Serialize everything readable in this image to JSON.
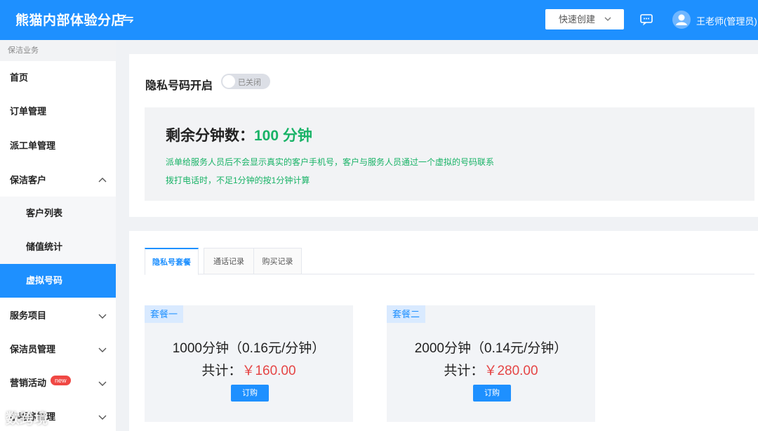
{
  "header": {
    "title": "熊猫内部体验分店",
    "switch_icon": "⇋",
    "quick_create": "快速创建",
    "user_name": "王老师(管理员)"
  },
  "sidebar": {
    "section": "保洁业务",
    "items": [
      {
        "label": "首页"
      },
      {
        "label": "订单管理"
      },
      {
        "label": "派工单管理"
      },
      {
        "label": "保洁客户"
      },
      {
        "label": "客户列表"
      },
      {
        "label": "储值统计"
      },
      {
        "label": "虚拟号码"
      },
      {
        "label": "服务项目"
      },
      {
        "label": "保洁员管理"
      },
      {
        "label": "营销活动",
        "badge": "new"
      },
      {
        "label": "小程序管理"
      }
    ]
  },
  "privacy": {
    "label": "隐私号码开启",
    "switch_text": "已关闭",
    "remain_label": "剩余分钟数：",
    "remain_value": "100 分钟",
    "line1": "派单给服务人员后不会显示真实的客户手机号，客户与服务人员通过一个虚拟的号码联系",
    "line2": "拨打电话时，不足1分钟的按1分钟计算"
  },
  "tabs": [
    "隐私号套餐",
    "通话记录",
    "购买记录"
  ],
  "plans": [
    {
      "tag": "套餐一",
      "title": "1000分钟（0.16元/分钟）",
      "total_label": "共计：",
      "price": "￥160.00",
      "button": "订购"
    },
    {
      "tag": "套餐二",
      "title": "2000分钟（0.14元/分钟）",
      "total_label": "共计：",
      "price": "￥280.00",
      "button": "订购"
    }
  ],
  "watermark": "数跨境",
  "colors": {
    "primary": "#1e90ff",
    "success": "#19b367",
    "price": "#e54545"
  }
}
